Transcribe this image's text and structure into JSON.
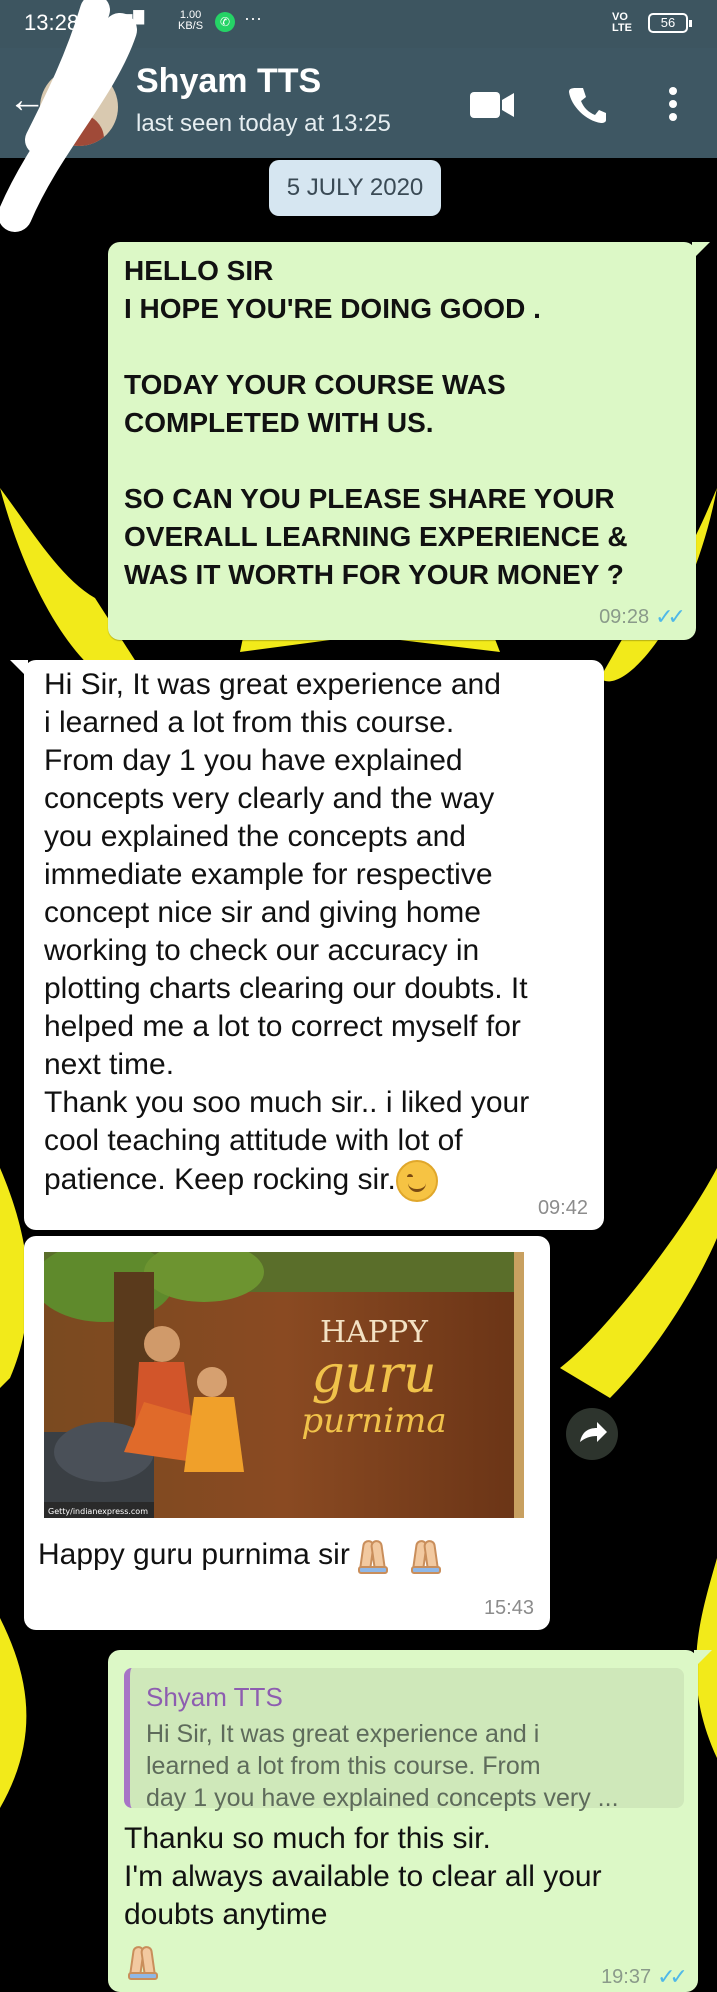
{
  "status_bar": {
    "time": "13:28",
    "net_speed": "1.00\nKB/S",
    "volte": "VO\nLTE",
    "battery": "56",
    "overflow": "···"
  },
  "header": {
    "contact_name": "Shyam TTS",
    "last_seen": "last seen today at 13:25"
  },
  "date_chip": "5 JULY 2020",
  "messages": [
    {
      "direction": "outgoing",
      "text": "HELLO SIR\n I HOPE YOU'RE DOING GOOD .\n\n TODAY YOUR COURSE WAS\nCOMPLETED WITH US.\n\n SO CAN YOU PLEASE SHARE YOUR\nOVERALL LEARNING EXPERIENCE &\nWAS IT WORTH FOR YOUR MONEY ?",
      "time": "09:28",
      "status": "read"
    },
    {
      "direction": "incoming",
      "text": "Hi Sir, It was great experience and\ni learned a lot from this course.\nFrom day 1 you have explained\nconcepts very clearly and the way\nyou explained the concepts and\nimmediate example for respective\nconcept nice sir and giving home\nworking to check our accuracy in\nplotting charts clearing our doubts. It\nhelped me a lot to correct myself for\nnext time.\nThank you soo much sir.. i liked your\ncool teaching attitude with lot of\npatience. Keep rocking sir.",
      "time": "09:42"
    },
    {
      "direction": "incoming",
      "image_text": {
        "happy": "HAPPY",
        "guru": "guru",
        "purnima": "purnima",
        "credit": "Getty/indianexpress.com"
      },
      "caption": "Happy guru purnima sir",
      "time": "15:43"
    },
    {
      "direction": "outgoing",
      "quoted": {
        "author": "Shyam TTS",
        "text": "Hi Sir, It was great experience and i\nlearned a lot from this course.  From\nday 1 you have explained concepts very ..."
      },
      "text": "Thanku so much for this sir.\nI'm always available to clear all your\ndoubts anytime",
      "time": "19:37",
      "status": "read"
    }
  ],
  "icons": [
    "back-arrow-icon",
    "video-call-icon",
    "voice-call-icon",
    "more-options-icon",
    "forward-icon",
    "smile-emoji-icon",
    "folded-hands-emoji-icon",
    "read-ticks-icon"
  ],
  "colors": {
    "header": "#3e5763",
    "outgoing_bubble": "#dcf8c6",
    "incoming_bubble": "#ffffff",
    "wallpaper_bg": "#000000",
    "wallpaper_accent": "#f2ea1a",
    "read_ticks": "#4fb8e8"
  }
}
